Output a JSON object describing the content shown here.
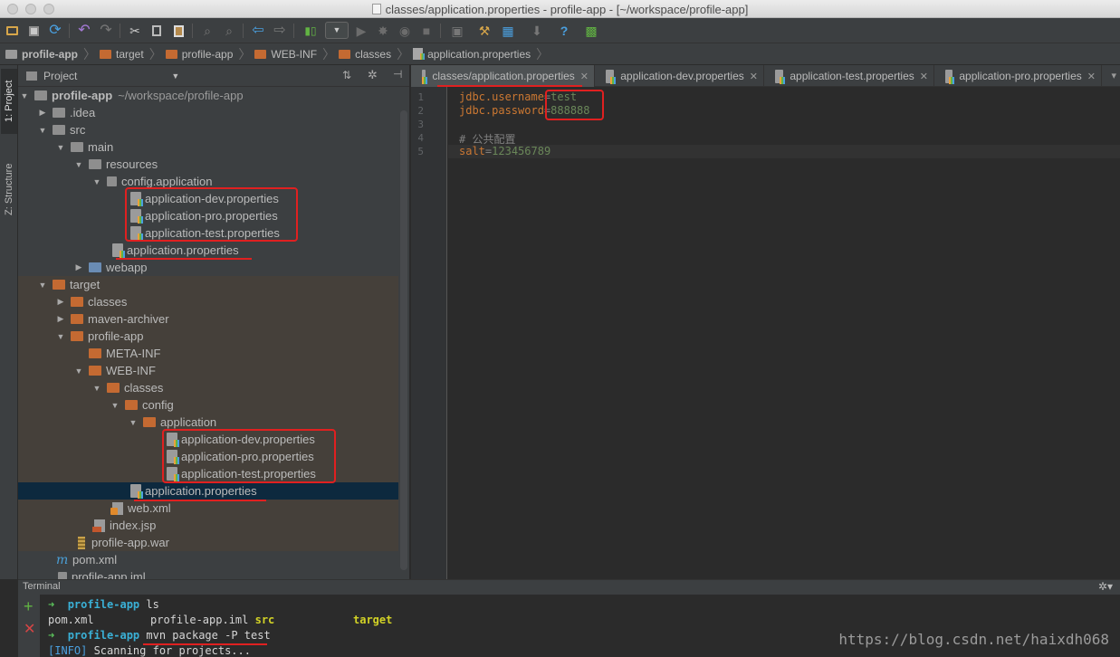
{
  "window": {
    "title": "classes/application.properties - profile-app - [~/workspace/profile-app]"
  },
  "breadcrumb": [
    "profile-app",
    "target",
    "profile-app",
    "WEB-INF",
    "classes",
    "application.properties"
  ],
  "left_strip": {
    "project_tab": "1: Project",
    "structure_tab": "Z: Structure"
  },
  "project_panel": {
    "title": "Project",
    "root_name": "profile-app",
    "root_path": "~/workspace/profile-app",
    "items": [
      "profile-app",
      ".idea",
      "src",
      "main",
      "resources",
      "config.application",
      "application-dev.properties",
      "application-pro.properties",
      "application-test.properties",
      "application.properties",
      "webapp",
      "target",
      "classes",
      "maven-archiver",
      "profile-app",
      "META-INF",
      "WEB-INF",
      "classes",
      "config",
      "application",
      "application-dev.properties",
      "application-pro.properties",
      "application-test.properties",
      "application.properties",
      "web.xml",
      "index.jsp",
      "profile-app.war",
      "pom.xml",
      "profile-app.iml"
    ]
  },
  "editor": {
    "tabs": [
      "classes/application.properties",
      "application-dev.properties",
      "application-test.properties",
      "application-pro.properties"
    ],
    "line_numbers": [
      "1",
      "2",
      "3",
      "4",
      "5"
    ],
    "lines": [
      {
        "key": "jdbc.username",
        "eq": "=",
        "val": "test"
      },
      {
        "key": "jdbc.password",
        "eq": "=",
        "val": "888888"
      },
      {
        "key": "",
        "eq": "",
        "val": ""
      },
      {
        "comment": "# 公共配置"
      },
      {
        "key": "salt",
        "eq": "=",
        "val": "123456789"
      }
    ]
  },
  "terminal": {
    "title": "Terminal",
    "prompt_dir": "profile-app",
    "line1_cmd": "ls",
    "ls_output": {
      "a": "pom.xml",
      "b": "profile-app.iml",
      "c": "src",
      "d": "target"
    },
    "line3_cmd": "mvn package -P test",
    "line4_tag": "[INFO]",
    "line4_text": " Scanning for projects..."
  },
  "watermark": "https://blog.csdn.net/haixdh068"
}
